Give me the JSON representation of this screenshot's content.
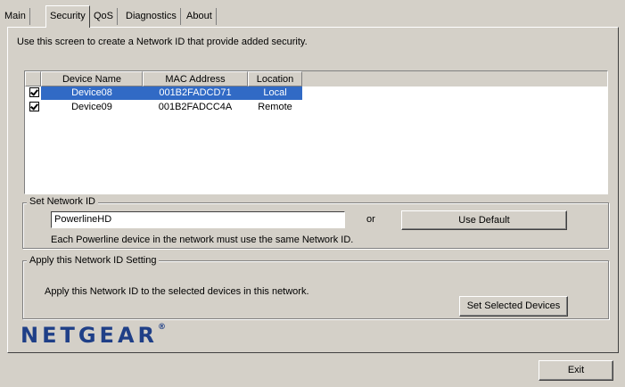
{
  "tabs": [
    {
      "label": "Main"
    },
    {
      "label": "Security",
      "active": true
    },
    {
      "label": "QoS"
    },
    {
      "label": "Diagnostics"
    },
    {
      "label": "About"
    }
  ],
  "intro_text": "Use this screen to create a Network ID that provide added security.",
  "device_list": {
    "columns": [
      "Device Name",
      "MAC Address",
      "Location"
    ],
    "rows": [
      {
        "checked": true,
        "selected": true,
        "name": "Device08",
        "mac": "001B2FADCD71",
        "location": "Local"
      },
      {
        "checked": true,
        "selected": false,
        "name": "Device09",
        "mac": "001B2FADCC4A",
        "location": "Remote"
      }
    ]
  },
  "set_network_id": {
    "legend": "Set Network ID",
    "value": "PowerlineHD",
    "or_label": "or",
    "use_default_label": "Use Default",
    "note": "Each Powerline device in the network must use the same Network ID."
  },
  "apply": {
    "legend": "Apply this Network ID Setting",
    "text": "Apply this Network ID to the selected devices in this network.",
    "button_label": "Set Selected Devices"
  },
  "logo": {
    "text": "NETGEAR",
    "mark": "®",
    "color": "#1f3f87"
  },
  "exit_label": "Exit",
  "colors": {
    "selection": "#316ac5",
    "window": "#d4d0c8"
  }
}
